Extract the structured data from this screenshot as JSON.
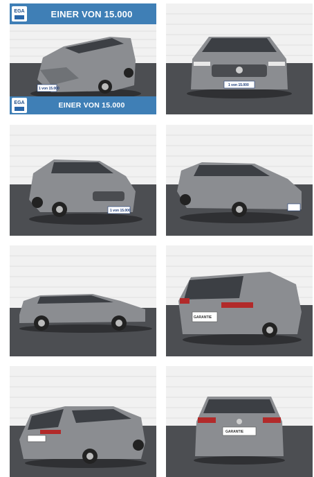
{
  "gallery": {
    "banner_top_text": "EINER VON 15.000",
    "banner_bottom_text": "EINER VON 15.000",
    "logo_text": "EGA",
    "plate_front_text": "1 von 15.000",
    "plate_rear_text": "GARANTIE"
  },
  "colors": {
    "banner": "#3f7fb6",
    "car_body": "#8b8d91",
    "floor": "#4c4e52",
    "wall": "#f1f1f1"
  }
}
